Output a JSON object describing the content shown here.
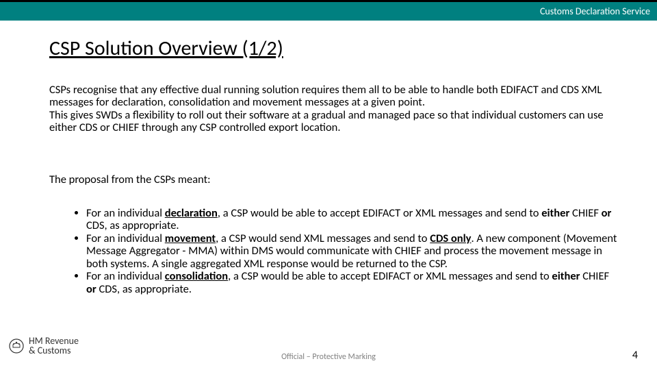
{
  "header": {
    "service_name": "Customs Declaration Service"
  },
  "title": "CSP Solution Overview (1/2)",
  "intro": {
    "p1_a": "CSPs recognise that any effective dual running solution requires them all to be able to handle both EDIFACT and CDS XML messages for declaration, consolidation and movement messages at a given point.",
    "p1_b": "This gives SWDs a flexibility to roll out their software at a gradual and managed pace so that individual customers can use either CDS or CHIEF through any CSP controlled export location."
  },
  "proposal_intro": "The proposal from the CSPs meant:",
  "bullets": {
    "b1": {
      "pre": "For an individual ",
      "bold1": "declaration",
      "mid": ", a CSP would be able to accept EDIFACT or XML messages and send to ",
      "bold2": "either",
      "mid2": " CHIEF ",
      "bold3": "or",
      "post": " CDS, as appropriate."
    },
    "b2": {
      "pre": "For an individual ",
      "bold1": "movement",
      "mid": ", a CSP would send XML messages and send to ",
      "bold2": "CDS only",
      "post": ". A new component (Movement Message Aggregator - MMA) within DMS would communicate with CHIEF and process the movement message in both systems. A single aggregated XML response would be returned to the CSP."
    },
    "b3": {
      "pre": "For an individual ",
      "bold1": "consolidation",
      "mid": ", a CSP would be able to accept EDIFACT or XML messages and send to ",
      "bold2": "either",
      "mid2": " CHIEF ",
      "bold3": "or",
      "post": " CDS, as appropriate."
    }
  },
  "logo": {
    "line1": "HM Revenue",
    "line2": "& Customs"
  },
  "footer": {
    "marking": "Official – Protective Marking",
    "page": "4"
  }
}
